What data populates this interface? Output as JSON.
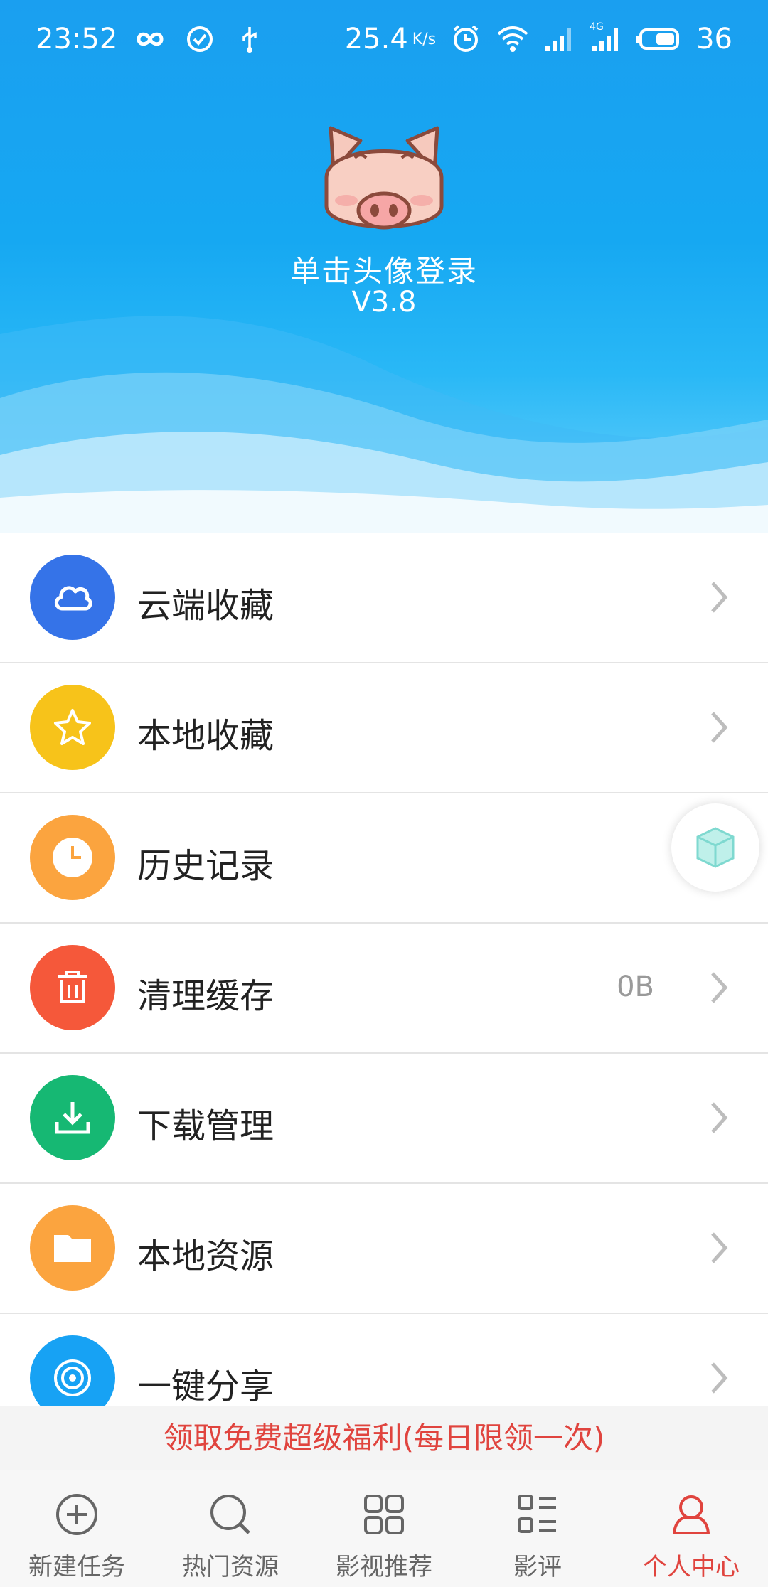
{
  "status_bar": {
    "time": "23:52",
    "speed": "25.4",
    "speed_unit": "K/s",
    "battery": "36",
    "network": "4G",
    "icons": [
      "infinity-icon",
      "check-circle-icon",
      "usb-icon",
      "alarm-icon",
      "wifi-icon",
      "signal-icon",
      "battery-icon"
    ]
  },
  "profile": {
    "avatar": "pig-avatar",
    "login_prompt": "单击头像登录",
    "version": "V3.8"
  },
  "menu": {
    "items": [
      {
        "label": "云端收藏",
        "icon": "cloud-icon",
        "color": "#3573e8",
        "value": ""
      },
      {
        "label": "本地收藏",
        "icon": "star-icon",
        "color": "#f7c31a",
        "value": ""
      },
      {
        "label": "历史记录",
        "icon": "clock-icon",
        "color": "#fba43f",
        "value": ""
      },
      {
        "label": "清理缓存",
        "icon": "trash-icon",
        "color": "#f5583a",
        "value": "0B"
      },
      {
        "label": "下载管理",
        "icon": "download-icon",
        "color": "#16b873",
        "value": ""
      },
      {
        "label": "本地资源",
        "icon": "folder-icon",
        "color": "#fba43f",
        "value": ""
      },
      {
        "label": "一键分享",
        "icon": "share-signal-icon",
        "color": "#17a2f4",
        "value": ""
      }
    ]
  },
  "floating": {
    "icon": "cube-icon"
  },
  "promo": {
    "text": "领取免费超级福利(每日限领一次)"
  },
  "tabs": [
    {
      "label": "新建任务",
      "icon": "plus-circle-icon",
      "active": false
    },
    {
      "label": "热门资源",
      "icon": "search-icon",
      "active": false
    },
    {
      "label": "影视推荐",
      "icon": "grid-icon",
      "active": false
    },
    {
      "label": "影评",
      "icon": "list-icon",
      "active": false
    },
    {
      "label": "个人中心",
      "icon": "person-icon",
      "active": true
    }
  ],
  "colors": {
    "header_blue": "#1a9ff0",
    "accent_red": "#e0443e"
  }
}
